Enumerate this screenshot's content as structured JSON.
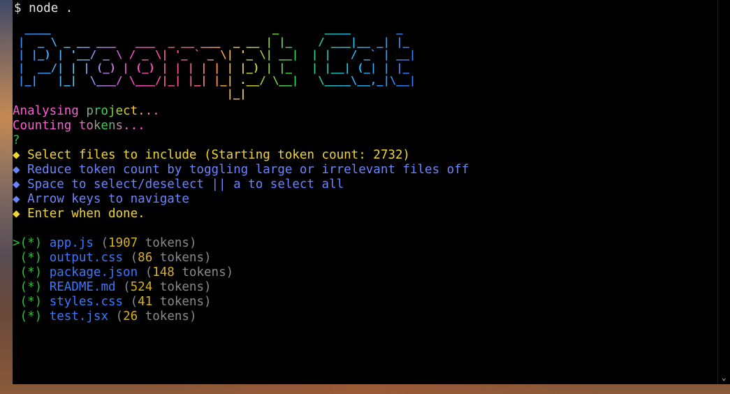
{
  "terminal": {
    "prompt_symbol": "$",
    "command": "node .",
    "banner_text": "Proompt Cat",
    "status_lines": [
      "Analysing project...",
      "Counting tokens..."
    ],
    "question_mark": "?",
    "bullet": "◆",
    "instructions": [
      {
        "text": "Select files to include (Starting token count: 2732)",
        "color": "#f2d633"
      },
      {
        "text": "Reduce token count by toggling large or irrelevant files off",
        "color": "#6a86ff"
      },
      {
        "text": "Space to select/deselect || a to select all",
        "color": "#6a86ff"
      },
      {
        "text": "Arrow keys to navigate",
        "color": "#6a86ff"
      },
      {
        "text": "Enter when done.",
        "color": "#f2d633"
      }
    ],
    "cursor": ">",
    "checkbox_marker": "(*)",
    "files": [
      {
        "name": "app.js",
        "tokens": "1907",
        "tokens_word": "tokens"
      },
      {
        "name": "output.css",
        "tokens": "86",
        "tokens_word": "tokens"
      },
      {
        "name": "package.json",
        "tokens": "148",
        "tokens_word": "tokens"
      },
      {
        "name": "README.md",
        "tokens": "524",
        "tokens_word": "tokens"
      },
      {
        "name": "styles.css",
        "tokens": "41",
        "tokens_word": "tokens"
      },
      {
        "name": "test.jsx",
        "tokens": "26",
        "tokens_word": "tokens"
      }
    ]
  }
}
